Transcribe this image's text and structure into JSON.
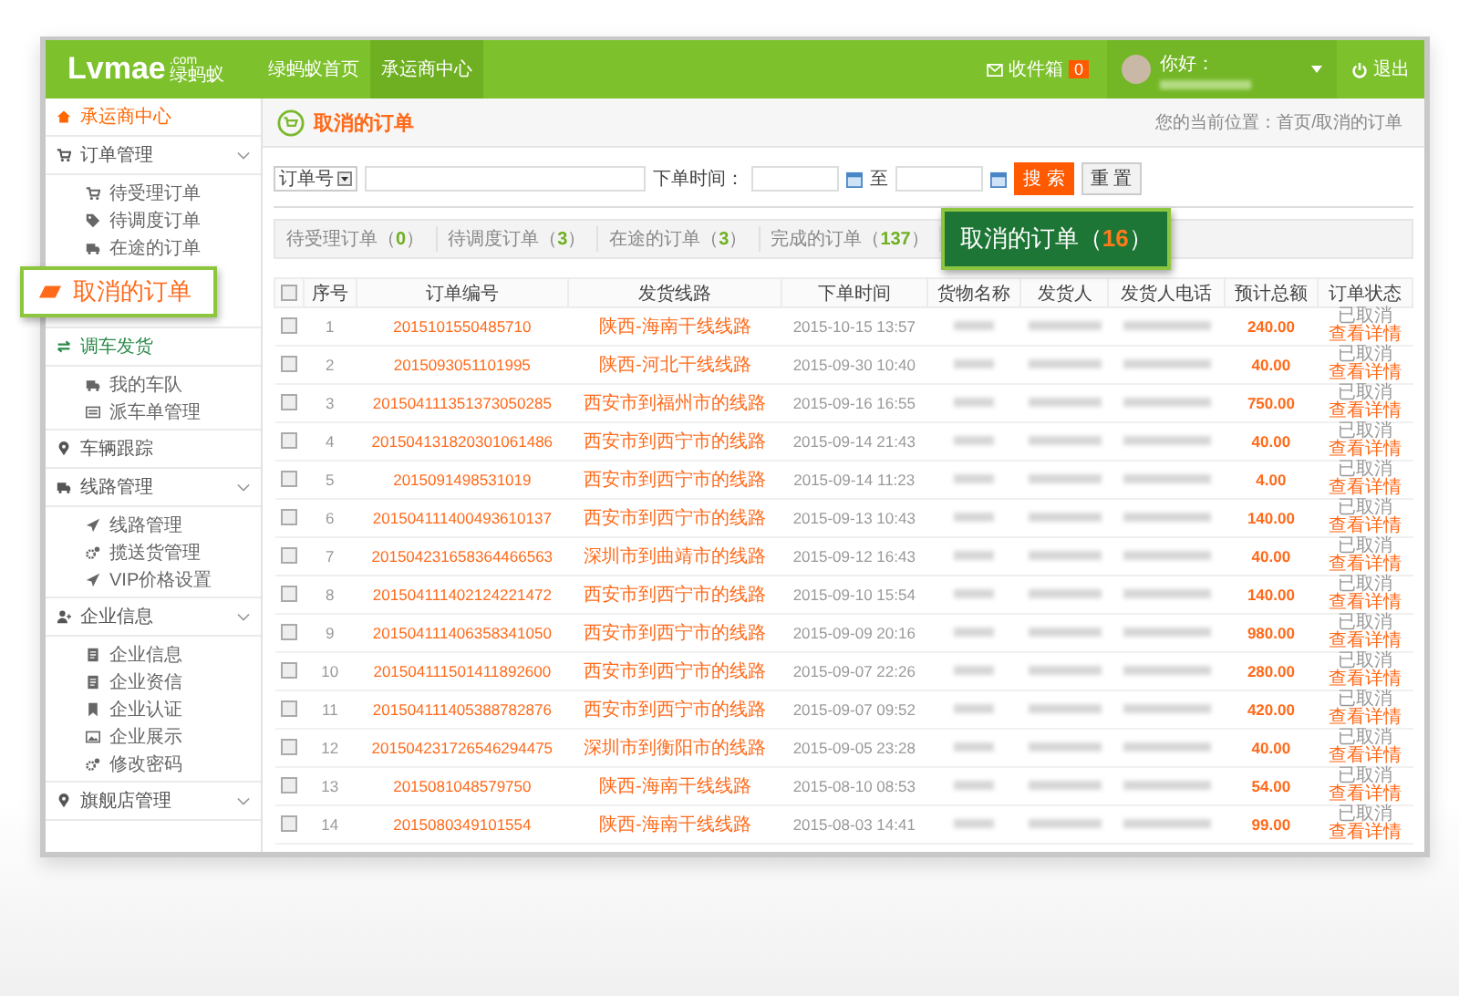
{
  "topbar": {
    "logo": "Lvmae",
    "logo_domain": ".com",
    "logo_cn": "绿蚂蚁",
    "nav": [
      {
        "label": "绿蚂蚁首页",
        "selected": false
      },
      {
        "label": "承运商中心",
        "selected": true
      }
    ],
    "inbox": {
      "label": "收件箱",
      "count": "0"
    },
    "greeting": "你好：",
    "logout": "退出"
  },
  "sidebar": {
    "sections": [
      {
        "label": "承运商中心",
        "color": "#ff6600",
        "collapsible": false
      },
      {
        "label": "订单管理",
        "color": "#555555",
        "collapsible": true,
        "children": [
          {
            "label": "待受理订单",
            "kind": "item"
          },
          {
            "label": "待调度订单",
            "kind": "item"
          },
          {
            "label": "在途的订单",
            "kind": "item"
          },
          {
            "label": "取消的订单",
            "kind": "callout"
          }
        ]
      },
      {
        "label": "调车发货",
        "color": "#2a8a4a",
        "collapsible": false,
        "children": [
          {
            "label": "我的车队",
            "kind": "item"
          },
          {
            "label": "派车单管理",
            "kind": "item"
          }
        ]
      },
      {
        "label": "车辆跟踪",
        "color": "#555555",
        "collapsible": false
      },
      {
        "label": "线路管理",
        "color": "#555555",
        "collapsible": true,
        "children": [
          {
            "label": "线路管理",
            "kind": "item"
          },
          {
            "label": "揽送货管理",
            "kind": "item"
          },
          {
            "label": "VIP价格设置",
            "kind": "item"
          }
        ]
      },
      {
        "label": "企业信息",
        "color": "#555555",
        "collapsible": true,
        "children": [
          {
            "label": "企业信息",
            "kind": "item"
          },
          {
            "label": "企业资信",
            "kind": "item"
          },
          {
            "label": "企业认证",
            "kind": "item"
          },
          {
            "label": "企业展示",
            "kind": "item"
          },
          {
            "label": "修改密码",
            "kind": "item"
          }
        ]
      },
      {
        "label": "旗舰店管理",
        "color": "#555555",
        "collapsible": true
      }
    ]
  },
  "page": {
    "title": "取消的订单",
    "breadcrumb": "您的当前位置：首页/取消的订单"
  },
  "search": {
    "field_select": "订单号",
    "time_label": "下单时间：",
    "to_label": "至",
    "search_button": "搜 索",
    "reset_button": "重 置"
  },
  "tabs": {
    "open": "（",
    "close": "）",
    "items": [
      {
        "label": "待受理订单",
        "count": "0",
        "selected": false
      },
      {
        "label": "待调度订单",
        "count": "3",
        "selected": false
      },
      {
        "label": "在途的订单",
        "count": "3",
        "selected": false
      },
      {
        "label": "完成的订单",
        "count": "137",
        "selected": false
      },
      {
        "label": "取消的订单",
        "count": "16",
        "selected": true
      }
    ]
  },
  "table": {
    "select_all_checked": false,
    "columns": [
      "序号",
      "订单编号",
      "发货线路",
      "下单时间",
      "货物名称",
      "发货人",
      "发货人电话",
      "预计总额",
      "订单状态"
    ],
    "rows": [
      {
        "checked": false,
        "no": "1",
        "order": "2015101550485710",
        "route": "陕西-海南干线线路",
        "time": "2015-10-15 13:57",
        "total": "240.00",
        "status": "已取消",
        "action": "查看详情"
      },
      {
        "checked": false,
        "no": "2",
        "order": "2015093051101995",
        "route": "陕西-河北干线线路",
        "time": "2015-09-30 10:40",
        "total": "40.00",
        "status": "已取消",
        "action": "查看详情"
      },
      {
        "checked": false,
        "no": "3",
        "order": "201504111351373050285",
        "route": "西安市到福州市的线路",
        "time": "2015-09-16 16:55",
        "total": "750.00",
        "status": "已取消",
        "action": "查看详情"
      },
      {
        "checked": false,
        "no": "4",
        "order": "201504131820301061486",
        "route": "西安市到西宁市的线路",
        "time": "2015-09-14 21:43",
        "total": "40.00",
        "status": "已取消",
        "action": "查看详情"
      },
      {
        "checked": false,
        "no": "5",
        "order": "2015091498531019",
        "route": "西安市到西宁市的线路",
        "time": "2015-09-14 11:23",
        "total": "4.00",
        "status": "已取消",
        "action": "查看详情"
      },
      {
        "checked": false,
        "no": "6",
        "order": "201504111400493610137",
        "route": "西安市到西宁市的线路",
        "time": "2015-09-13 10:43",
        "total": "140.00",
        "status": "已取消",
        "action": "查看详情"
      },
      {
        "checked": false,
        "no": "7",
        "order": "201504231658364466563",
        "route": "深圳市到曲靖市的线路",
        "time": "2015-09-12 16:43",
        "total": "40.00",
        "status": "已取消",
        "action": "查看详情"
      },
      {
        "checked": false,
        "no": "8",
        "order": "201504111402124221472",
        "route": "西安市到西宁市的线路",
        "time": "2015-09-10 15:54",
        "total": "140.00",
        "status": "已取消",
        "action": "查看详情"
      },
      {
        "checked": false,
        "no": "9",
        "order": "201504111406358341050",
        "route": "西安市到西宁市的线路",
        "time": "2015-09-09 20:16",
        "total": "980.00",
        "status": "已取消",
        "action": "查看详情"
      },
      {
        "checked": false,
        "no": "10",
        "order": "201504111501411892600",
        "route": "西安市到西宁市的线路",
        "time": "2015-09-07 22:26",
        "total": "280.00",
        "status": "已取消",
        "action": "查看详情"
      },
      {
        "checked": false,
        "no": "11",
        "order": "201504111405388782876",
        "route": "西安市到西宁市的线路",
        "time": "2015-09-07 09:52",
        "total": "420.00",
        "status": "已取消",
        "action": "查看详情"
      },
      {
        "checked": false,
        "no": "12",
        "order": "201504231726546294475",
        "route": "深圳市到衡阳市的线路",
        "time": "2015-09-05 23:28",
        "total": "40.00",
        "status": "已取消",
        "action": "查看详情"
      },
      {
        "checked": false,
        "no": "13",
        "order": "2015081048579750",
        "route": "陕西-海南干线线路",
        "time": "2015-08-10 08:53",
        "total": "54.00",
        "status": "已取消",
        "action": "查看详情"
      },
      {
        "checked": false,
        "no": "14",
        "order": "2015080349101554",
        "route": "陕西-海南干线线路",
        "time": "2015-08-03 14:41",
        "total": "99.00",
        "status": "已取消",
        "action": "查看详情"
      }
    ]
  }
}
